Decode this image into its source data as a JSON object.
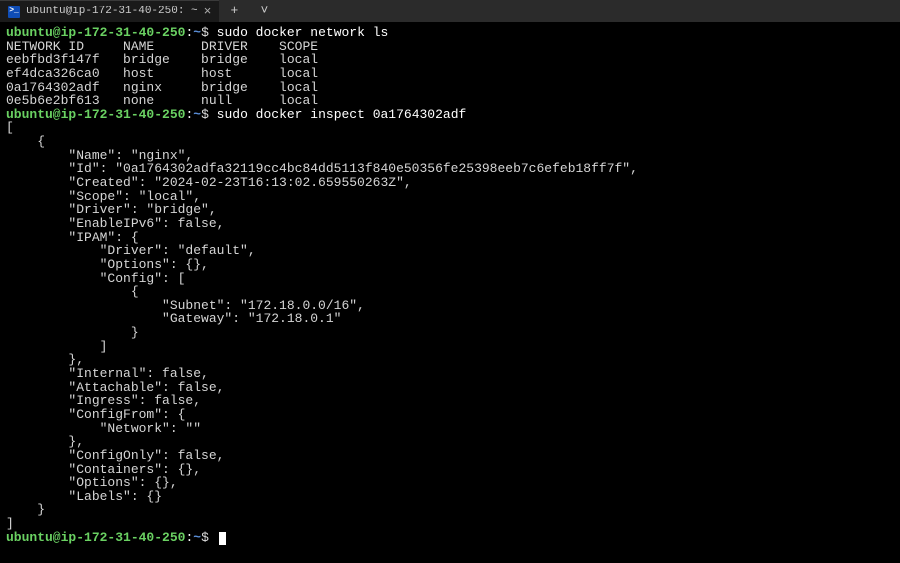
{
  "window": {
    "tab_title": "ubuntu@ip-172-31-40-250: ~",
    "tab_icon_glyph": ">_",
    "tab_close_glyph": "×",
    "new_tab_glyph": "+",
    "dropdown_glyph": "˅"
  },
  "prompt": {
    "user_host": "ubuntu@ip-172-31-40-250",
    "sep": ":",
    "path": "~",
    "symbol": "$"
  },
  "session": [
    {
      "command": "sudo docker network ls",
      "output_lines": [
        "NETWORK ID     NAME      DRIVER    SCOPE",
        "eebfbd3f147f   bridge    bridge    local",
        "ef4dca326ca0   host      host      local",
        "0a1764302adf   nginx     bridge    local",
        "0e5b6e2bf613   none      null      local"
      ]
    },
    {
      "command": "sudo docker inspect 0a1764302adf",
      "output_lines": [
        "[",
        "    {",
        "        \"Name\": \"nginx\",",
        "        \"Id\": \"0a1764302adfa32119cc4bc84dd5113f840e50356fe25398eeb7c6efeb18ff7f\",",
        "        \"Created\": \"2024-02-23T16:13:02.659550263Z\",",
        "        \"Scope\": \"local\",",
        "        \"Driver\": \"bridge\",",
        "        \"EnableIPv6\": false,",
        "        \"IPAM\": {",
        "            \"Driver\": \"default\",",
        "            \"Options\": {},",
        "            \"Config\": [",
        "                {",
        "                    \"Subnet\": \"172.18.0.0/16\",",
        "                    \"Gateway\": \"172.18.0.1\"",
        "                }",
        "            ]",
        "        },",
        "        \"Internal\": false,",
        "        \"Attachable\": false,",
        "        \"Ingress\": false,",
        "        \"ConfigFrom\": {",
        "            \"Network\": \"\"",
        "        },",
        "        \"ConfigOnly\": false,",
        "        \"Containers\": {},",
        "        \"Options\": {},",
        "        \"Labels\": {}",
        "    }",
        "]"
      ]
    },
    {
      "command": "",
      "output_lines": []
    }
  ]
}
